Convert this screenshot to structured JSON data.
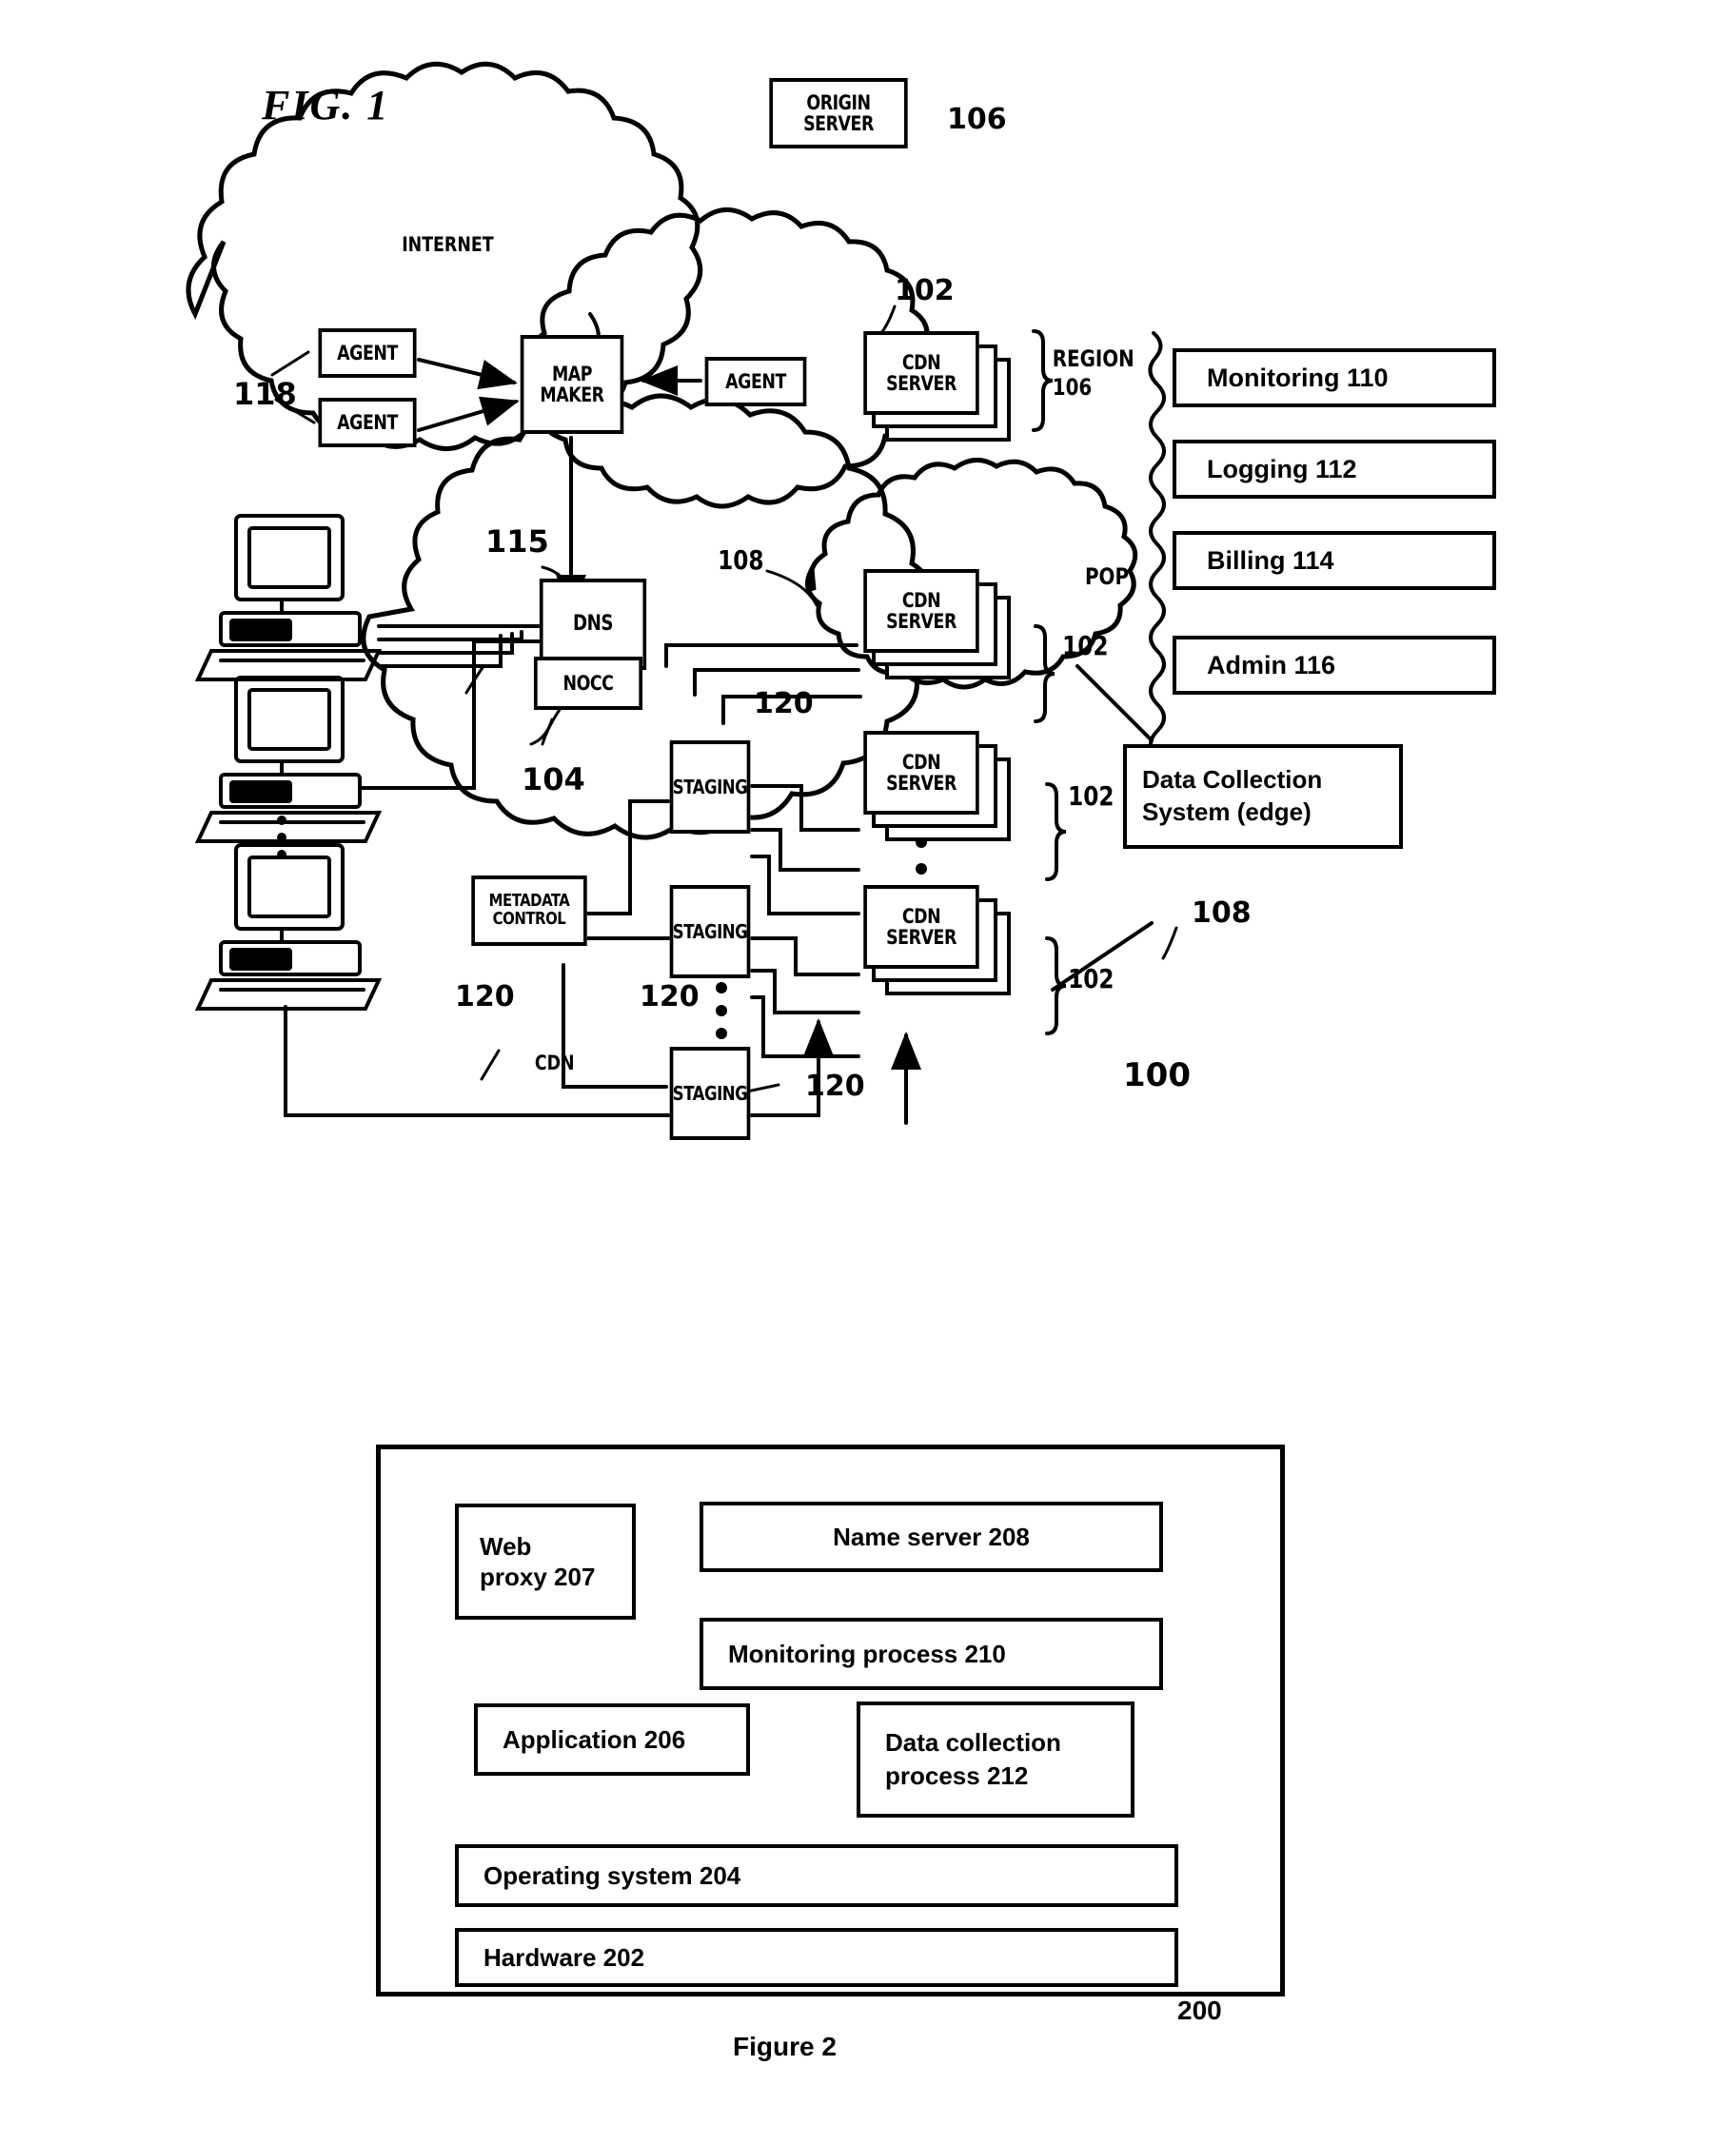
{
  "figure1": {
    "title": "FIG.  1",
    "origin_server": {
      "label": "ORIGIN\nSERVER",
      "ref": "106"
    },
    "internet_cloud_label": "INTERNET",
    "cdn_cloud_label": "CDN",
    "agents": [
      {
        "label": "AGENT"
      },
      {
        "label": "AGENT"
      },
      {
        "label": "AGENT"
      }
    ],
    "agent_ref": "118",
    "map_maker": {
      "label": "MAP\nMAKER"
    },
    "dns": {
      "label": "DNS",
      "ref": "115"
    },
    "nocc": {
      "label": "NOCC",
      "ref": "104"
    },
    "metadata_control": {
      "label": "METADATA\nCONTROL",
      "ref": "120"
    },
    "staging_boxes": [
      {
        "label": "STAGING",
        "ref": "120"
      },
      {
        "label": "STAGING",
        "ref": "120"
      },
      {
        "label": "STAGING",
        "ref": "120"
      }
    ],
    "cdn_servers": [
      {
        "label": "CDN\nSERVER",
        "ref": "102",
        "group": "REGION\n106"
      },
      {
        "label": "CDN\nSERVER",
        "ref": "102",
        "group": "POP"
      },
      {
        "label": "CDN\nSERVER",
        "ref": "102",
        "group": ""
      },
      {
        "label": "CDN\nSERVER",
        "ref": "102",
        "group": ""
      }
    ],
    "pop_label": "POP",
    "region_label": "REGION\n106",
    "pop_ref": "108",
    "data_collection": {
      "label": "Data Collection\nSystem (edge)",
      "ref": "108"
    },
    "cdn_ref": "100",
    "services": [
      {
        "label": "Monitoring 110"
      },
      {
        "label": "Logging 112"
      },
      {
        "label": "Billing 114"
      },
      {
        "label": "Admin 116"
      }
    ]
  },
  "figure2": {
    "caption": "Figure 2",
    "ref": "200",
    "boxes": [
      {
        "id": "web-proxy",
        "label": "Web\nproxy 207"
      },
      {
        "id": "name-server",
        "label": "Name server 208"
      },
      {
        "id": "monitoring-proc",
        "label": "Monitoring process 210"
      },
      {
        "id": "application",
        "label": "Application 206"
      },
      {
        "id": "data-collection",
        "label": "Data collection\nprocess 212"
      },
      {
        "id": "operating-system",
        "label": "Operating system 204"
      },
      {
        "id": "hardware",
        "label": "Hardware 202"
      }
    ]
  }
}
